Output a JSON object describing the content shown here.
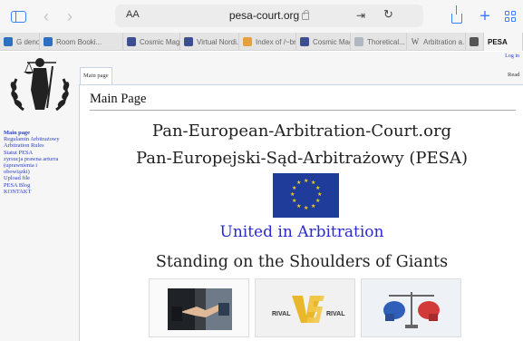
{
  "browser": {
    "reader_label": "AA",
    "url": "pesa-court.org"
  },
  "tabs": [
    {
      "label": "G  denour",
      "fav": "#2f6fbf"
    },
    {
      "label": "Room Booki...",
      "fav": "#2f6fbf"
    },
    {
      "label": "Cosmic Mag...",
      "fav": "#3d4f8f"
    },
    {
      "label": "Virtual Nordi...",
      "fav": "#3d4f8f"
    },
    {
      "label": "Index of /~br...",
      "fav": "#e4a23a"
    },
    {
      "label": "Cosmic Mag...",
      "fav": "#3d4f8f"
    },
    {
      "label": "Thoretical...",
      "fav": "#b0b7c3"
    },
    {
      "label": "Arbitration a...",
      "fav": "#7a7a7a"
    },
    {
      "label": "",
      "fav": "#555555"
    },
    {
      "label": "PESA",
      "fav": "#ffffff"
    }
  ],
  "wiki": {
    "login_label": "Log in",
    "tab_main": "Main page",
    "tab_read": "Read",
    "nav": [
      "Main page",
      "Regulamin Arbitrażowy",
      "Arbitration Rules",
      "Statut PESA",
      "zyrsucja prawna arturra",
      "(uprawnienia i",
      "obowiązki)",
      "Upload file",
      "PESA Blog",
      "KONTAKT"
    ],
    "page_title": "Main Page",
    "headline_1": "Pan-European-Arbitration-Court.org",
    "headline_2": "Pan-Europejski-Sąd-Arbitrażowy (PESA)",
    "motto": "United in Arbitration",
    "tagline": "Standing on the Shoulders of Giants",
    "rival_left": "RIVAL",
    "vs": "VS",
    "rival_right": "RIVAL"
  },
  "colors": {
    "link": "#2a3fbf",
    "accent": "#3b82f6",
    "flag_blue": "#1f3c9b",
    "flag_star": "#f7d21a",
    "motto": "#2a2ad4"
  }
}
